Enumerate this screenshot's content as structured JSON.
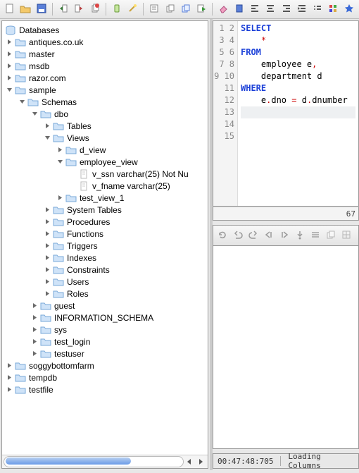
{
  "toolbar": {
    "icons": [
      "new",
      "open",
      "save",
      "sep",
      "import-left",
      "import-right",
      "copy-db",
      "sep",
      "battery",
      "wand",
      "sep",
      "notes",
      "copy",
      "copy2",
      "run",
      "sep",
      "eraser",
      "book",
      "align-left",
      "align-center",
      "align-right",
      "indent",
      "list",
      "palette",
      "star"
    ]
  },
  "tree": {
    "root": "Databases",
    "items": [
      {
        "label": "antiques.co.uk",
        "open": false
      },
      {
        "label": "master",
        "open": false
      },
      {
        "label": "msdb",
        "open": false
      },
      {
        "label": "razor.com",
        "open": false
      },
      {
        "label": "sample",
        "open": true,
        "children": [
          {
            "label": "Schemas",
            "open": true,
            "children": [
              {
                "label": "dbo",
                "open": true,
                "children": [
                  {
                    "label": "Tables",
                    "open": false
                  },
                  {
                    "label": "Views",
                    "open": true,
                    "children": [
                      {
                        "label": "d_view",
                        "open": false
                      },
                      {
                        "label": "employee_view",
                        "open": true,
                        "children": [
                          {
                            "label": "v_ssn varchar(25) Not Nu",
                            "leaf": true
                          },
                          {
                            "label": "v_fname varchar(25)",
                            "leaf": true
                          }
                        ]
                      },
                      {
                        "label": "test_view_1",
                        "open": false
                      }
                    ]
                  },
                  {
                    "label": "System Tables",
                    "open": false
                  },
                  {
                    "label": "Procedures",
                    "open": false
                  },
                  {
                    "label": "Functions",
                    "open": false
                  },
                  {
                    "label": "Triggers",
                    "open": false
                  },
                  {
                    "label": "Indexes",
                    "open": false
                  },
                  {
                    "label": "Constraints",
                    "open": false
                  },
                  {
                    "label": "Users",
                    "open": false
                  },
                  {
                    "label": "Roles",
                    "open": false
                  }
                ]
              },
              {
                "label": "guest",
                "open": false
              },
              {
                "label": "INFORMATION_SCHEMA",
                "open": false
              },
              {
                "label": "sys",
                "open": false
              },
              {
                "label": "test_login",
                "open": false
              },
              {
                "label": "testuser",
                "open": false
              }
            ]
          }
        ]
      },
      {
        "label": "soggybottomfarm",
        "open": false
      },
      {
        "label": "tempdb",
        "open": false
      },
      {
        "label": "testfile",
        "open": false
      }
    ]
  },
  "editor": {
    "line_count": 15,
    "position": "67",
    "tokens": [
      [
        {
          "t": "SELECT",
          "c": "kw"
        }
      ],
      [
        {
          "t": "    ",
          "c": ""
        },
        {
          "t": "*",
          "c": "op"
        }
      ],
      [
        {
          "t": "FROM",
          "c": "kw"
        }
      ],
      [
        {
          "t": "    employee e",
          "c": ""
        },
        {
          "t": ",",
          "c": "op"
        }
      ],
      [
        {
          "t": "    department d",
          "c": ""
        }
      ],
      [
        {
          "t": "WHERE",
          "c": "kw"
        }
      ],
      [
        {
          "t": "    e",
          "c": ""
        },
        {
          "t": ".",
          "c": "op"
        },
        {
          "t": "dno ",
          "c": ""
        },
        {
          "t": "=",
          "c": "op"
        },
        {
          "t": " d",
          "c": ""
        },
        {
          "t": ".",
          "c": "op"
        },
        {
          "t": "dnumber",
          "c": ""
        }
      ],
      [],
      [],
      [],
      [],
      [],
      [],
      [],
      []
    ]
  },
  "mid_toolbar": {
    "icons": [
      "refresh",
      "undo",
      "redo",
      "step-back",
      "step-fwd",
      "step-into",
      "rows",
      "copy",
      "grid"
    ]
  },
  "status": {
    "time": "00:47:48:705",
    "msg": "Loading Columns"
  }
}
